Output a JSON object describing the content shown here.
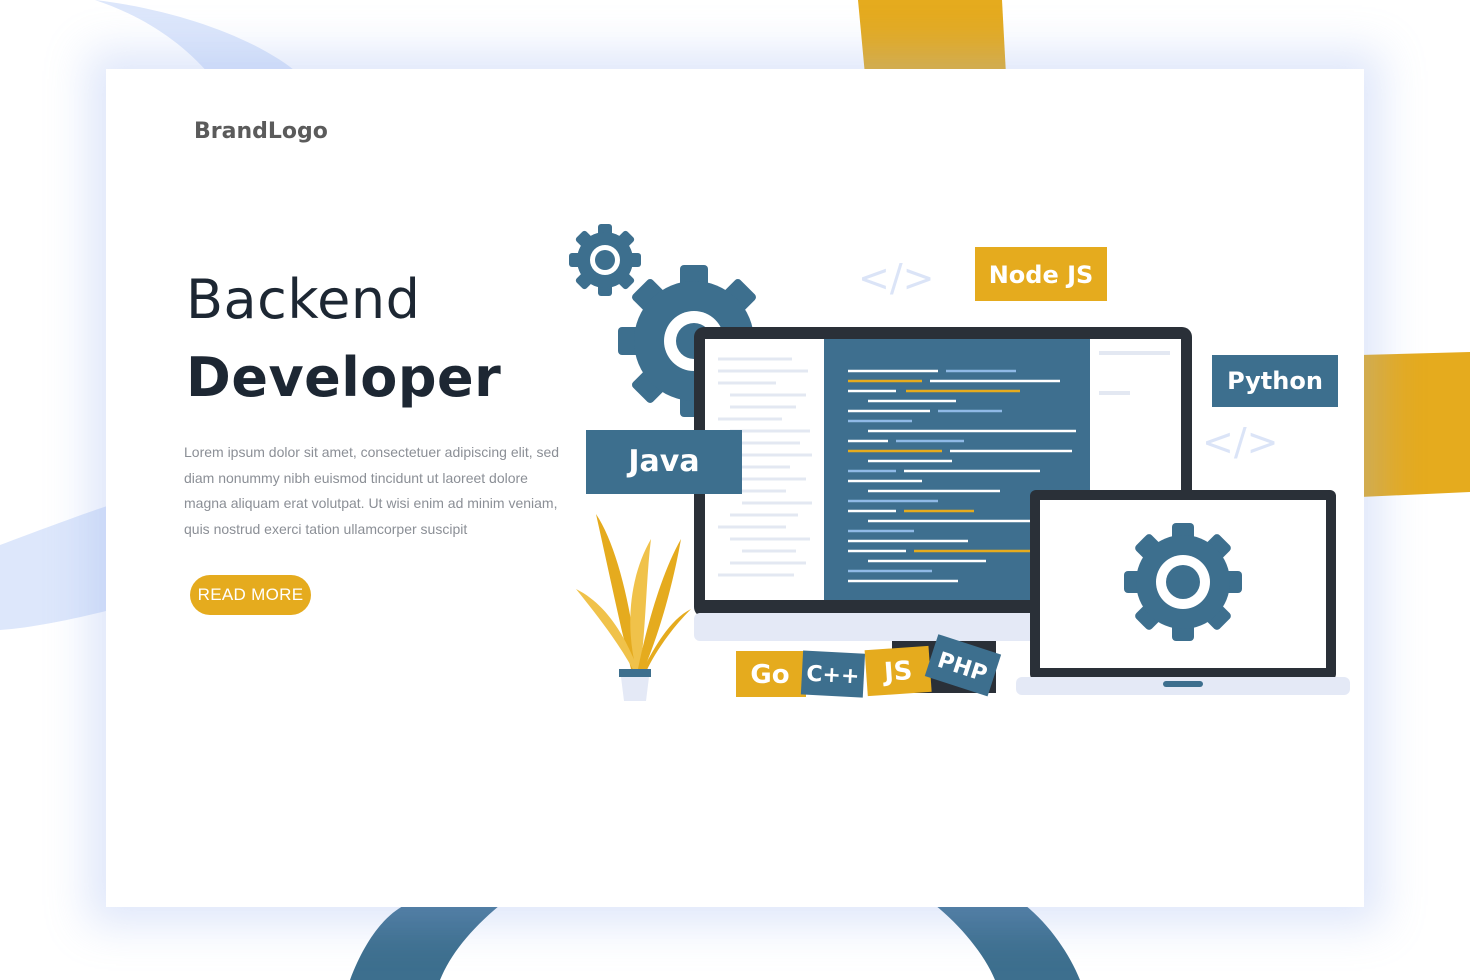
{
  "brand": {
    "name": "BrandLogo"
  },
  "hero": {
    "title_line1": "Backend",
    "title_line2": "Developer",
    "description": "Lorem ipsum dolor sit amet, consectetuer adipiscing elit, sed diam nonummy nibh euismod tincidunt ut laoreet dolore magna aliquam erat volutpat. Ut wisi enim ad minim veniam, quis nostrud exerci tation ullamcorper suscipit",
    "cta_label": "READ MORE"
  },
  "illustration": {
    "tags": {
      "node": "Node JS",
      "python": "Python",
      "java": "Java",
      "go": "Go",
      "cpp": "C++",
      "js": "JS",
      "php": "PHP"
    },
    "code_symbol": "</>"
  },
  "colors": {
    "accent": "#e5ab1e",
    "primary": "#3d6f8e",
    "dark": "#1d2733",
    "muted": "#8b8f96",
    "background_swoosh": "#d7e3fb"
  },
  "icons": [
    "gear-icon",
    "code-brackets-icon",
    "plant-icon",
    "monitor-icon",
    "laptop-icon"
  ]
}
